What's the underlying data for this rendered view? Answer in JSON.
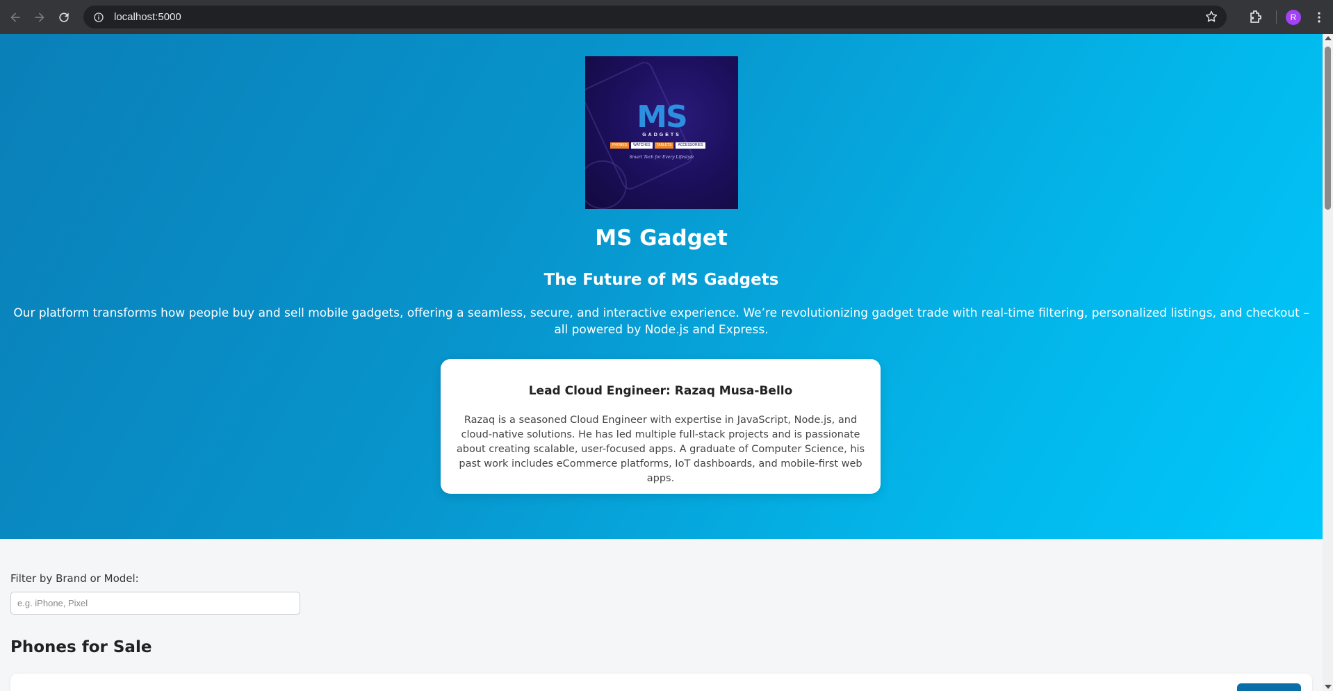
{
  "browser": {
    "url": "localhost:5000",
    "profile_initial": "R",
    "icons": [
      "back-icon",
      "forward-icon",
      "reload-icon",
      "info-icon",
      "star-icon",
      "extensions-icon",
      "kebab-menu-icon"
    ]
  },
  "hero": {
    "logo": {
      "mark": "MS",
      "wordmark": "GADGETS",
      "tags": [
        "PHONES",
        "WATCHES",
        "TABLETS",
        "ACCESSORIES"
      ],
      "tagline": "Smart Tech for Every Lifestyle"
    },
    "title": "MS Gadget",
    "subtitle": "The Future of MS Gadgets",
    "intro": "Our platform transforms how people buy and sell mobile gadgets, offering a seamless, secure, and interactive experience. We’re revolutionizing gadget trade with real-time filtering, personalized listings, and checkout – all powered by Node.js and Express."
  },
  "profile_card": {
    "heading": "Lead Cloud Engineer: Razaq Musa-Bello",
    "bio": "Razaq is a seasoned Cloud Engineer with expertise in JavaScript, Node.js, and cloud-native solutions. He has led multiple full-stack projects and is passionate about creating scalable, user-focused apps. A graduate of Computer Science, his past work includes eCommerce platforms, IoT dashboards, and mobile-first web apps."
  },
  "filter": {
    "label": "Filter by Brand or Model:",
    "value": "",
    "placeholder": "e.g. iPhone, Pixel"
  },
  "listings": {
    "title": "Phones for Sale"
  },
  "colors": {
    "hero_start": "#0a7fb8",
    "hero_end": "#00c8fb",
    "page_bg": "#f4f6f8",
    "button": "#0a6fa8",
    "avatar": "#a142f4"
  }
}
